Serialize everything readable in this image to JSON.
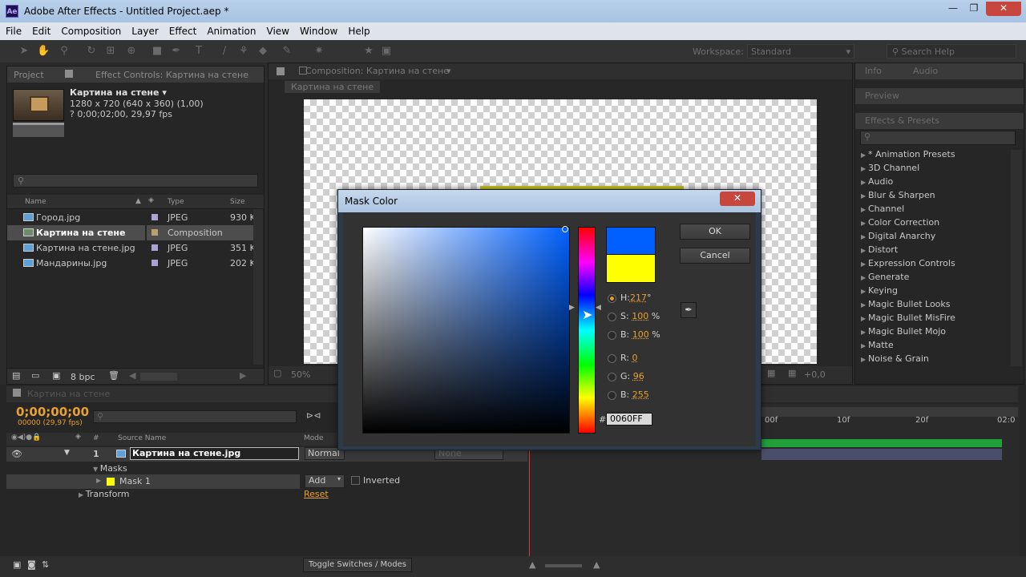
{
  "window": {
    "title": "Adobe After Effects - Untitled Project.aep *",
    "app_icon": "Ae"
  },
  "menu": [
    "File",
    "Edit",
    "Composition",
    "Layer",
    "Effect",
    "Animation",
    "View",
    "Window",
    "Help"
  ],
  "toolbar": {
    "workspace_label": "Workspace:",
    "workspace_value": "Standard",
    "search_placeholder": "Search Help"
  },
  "project": {
    "tab_project": "Project",
    "tab_effect_controls": "Effect Controls: Картина на стене",
    "selected_name": "Картина на стене ▾",
    "selected_info1": "1280 x 720  (640 x 360) (1,00)",
    "selected_info2": "? 0;00;02;00, 29,97 fps",
    "columns": {
      "name": "Name",
      "type": "Type",
      "size": "Size"
    },
    "items": [
      {
        "name": "Город.jpg",
        "type": "JPEG",
        "size": "930 K"
      },
      {
        "name": "Картина на стене",
        "type": "Composition",
        "size": ""
      },
      {
        "name": "Картина на стене.jpg",
        "type": "JPEG",
        "size": "351 K"
      },
      {
        "name": "Мандарины.jpg",
        "type": "JPEG",
        "size": "202 K"
      }
    ],
    "bpc": "8 bpc"
  },
  "comp": {
    "tab": "Composition: Картина на стене",
    "subtab": "Картина на стене",
    "zoom": "50%",
    "time": "+0,0"
  },
  "right_panels": {
    "info": "Info",
    "audio": "Audio",
    "preview": "Preview",
    "effects": "Effects & Presets",
    "effects_list": [
      "* Animation Presets",
      "3D Channel",
      "Audio",
      "Blur & Sharpen",
      "Channel",
      "Color Correction",
      "Digital Anarchy",
      "Distort",
      "Expression Controls",
      "Generate",
      "Keying",
      "Magic Bullet Looks",
      "Magic Bullet MisFire",
      "Magic Bullet Mojo",
      "Matte",
      "Noise & Grain"
    ]
  },
  "timeline": {
    "tab": "Картина на стене",
    "timecode": "0;00;00;00",
    "timecode_sub": "00000 (29,97 fps)",
    "col_source": "Source Name",
    "col_mode": "Mode",
    "layer_num": "1",
    "layer_name": "Картина на стене.jpg",
    "layer_mode": "Normal",
    "layer_parent": "None",
    "masks": "Masks",
    "mask_name": "Mask 1",
    "mask_mode": "Add",
    "inverted": "Inverted",
    "transform": "Transform",
    "reset": "Reset",
    "toggle": "Toggle Switches / Modes",
    "ruler": [
      "00f",
      "10f",
      "20f",
      "02:0"
    ]
  },
  "dialog": {
    "title": "Mask Color",
    "ok": "OK",
    "cancel": "Cancel",
    "h_label": "H:",
    "h_value": "217",
    "h_unit": "°",
    "s_label": "S:",
    "s_value": "100",
    "s_unit": "%",
    "b_label": "B:",
    "b_value": "100",
    "b_unit": "%",
    "r_label": "R:",
    "r_value": "0",
    "g_label": "G:",
    "g_value": "96",
    "bb_label": "B:",
    "bb_value": "255",
    "hex_label": "#",
    "hex_value": "0060FF",
    "new_color": "#0060ff",
    "old_color": "#ffff00"
  },
  "colors": {
    "accent": "#e8a030",
    "selection": "#0060ff"
  }
}
